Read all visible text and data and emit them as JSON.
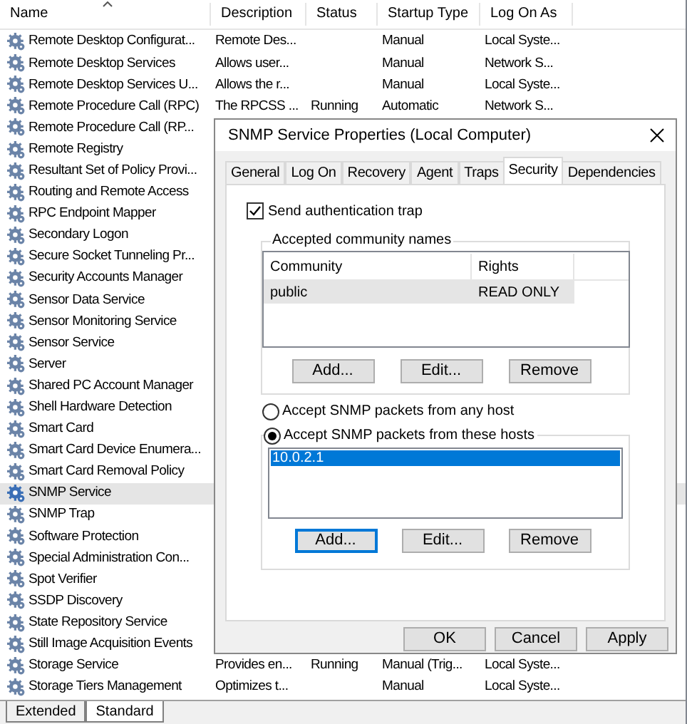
{
  "services": {
    "columns": [
      "Name",
      "Description",
      "Status",
      "Startup Type",
      "Log On As"
    ],
    "rows": [
      {
        "name": "Remote Desktop Configurat...",
        "description": "Remote Des...",
        "startup_type": "Manual",
        "log_on_as": "Local Syste...",
        "selected": false
      },
      {
        "name": "Remote Desktop Services",
        "description": "Allows user...",
        "startup_type": "Manual",
        "log_on_as": "Network S...",
        "selected": false
      },
      {
        "name": "Remote Desktop Services U...",
        "description": "Allows the r...",
        "startup_type": "Manual",
        "log_on_as": "Local Syste...",
        "selected": false
      },
      {
        "name": "Remote Procedure Call (RPC)",
        "description": "The RPCSS ...",
        "status": "Running",
        "startup_type": "Automatic",
        "log_on_as": "Network S...",
        "selected": false
      },
      {
        "name": "Remote Procedure Call (RP...",
        "selected": false
      },
      {
        "name": "Remote Registry",
        "selected": false
      },
      {
        "name": "Resultant Set of Policy Provi...",
        "selected": false
      },
      {
        "name": "Routing and Remote Access",
        "selected": false
      },
      {
        "name": "RPC Endpoint Mapper",
        "selected": false
      },
      {
        "name": "Secondary Logon",
        "selected": false
      },
      {
        "name": "Secure Socket Tunneling Pr...",
        "selected": false
      },
      {
        "name": "Security Accounts Manager",
        "selected": false
      },
      {
        "name": "Sensor Data Service",
        "selected": false
      },
      {
        "name": "Sensor Monitoring Service",
        "selected": false
      },
      {
        "name": "Sensor Service",
        "selected": false
      },
      {
        "name": "Server",
        "selected": false
      },
      {
        "name": "Shared PC Account Manager",
        "selected": false
      },
      {
        "name": "Shell Hardware Detection",
        "selected": false
      },
      {
        "name": "Smart Card",
        "selected": false
      },
      {
        "name": "Smart Card Device Enumera...",
        "selected": false
      },
      {
        "name": "Smart Card Removal Policy",
        "selected": false
      },
      {
        "name": "SNMP Service",
        "selected": true
      },
      {
        "name": "SNMP Trap",
        "selected": false
      },
      {
        "name": "Software Protection",
        "selected": false
      },
      {
        "name": "Special Administration Con...",
        "selected": false
      },
      {
        "name": "Spot Verifier",
        "selected": false
      },
      {
        "name": "SSDP Discovery",
        "selected": false
      },
      {
        "name": "State Repository Service",
        "selected": false
      },
      {
        "name": "Still Image Acquisition Events",
        "selected": false
      },
      {
        "name": "Storage Service",
        "description": "Provides en...",
        "status": "Running",
        "startup_type": "Manual (Trig...",
        "log_on_as": "Local Syste...",
        "selected": false
      },
      {
        "name": "Storage Tiers Management",
        "description": "Optimizes t...",
        "startup_type": "Manual",
        "log_on_as": "Local Syste...",
        "selected": false
      }
    ]
  },
  "view_tabs": [
    {
      "label": "Extended",
      "selected": false
    },
    {
      "label": "Standard",
      "selected": true
    }
  ],
  "dialog": {
    "title": "SNMP Service Properties (Local Computer)",
    "tabs": [
      {
        "label": "General",
        "selected": false
      },
      {
        "label": "Log On",
        "selected": false
      },
      {
        "label": "Recovery",
        "selected": false
      },
      {
        "label": "Agent",
        "selected": false
      },
      {
        "label": "Traps",
        "selected": false
      },
      {
        "label": "Security",
        "selected": true
      },
      {
        "label": "Dependencies",
        "selected": false
      }
    ],
    "send_auth_trap": {
      "label": "Send authentication trap",
      "checked": true
    },
    "community_group": {
      "title": "Accepted community names",
      "columns": [
        "Community",
        "Rights"
      ],
      "rows": [
        {
          "community": "public",
          "rights": "READ ONLY",
          "selected": true
        }
      ],
      "buttons": [
        {
          "label": "Add...",
          "focused": false
        },
        {
          "label": "Edit...",
          "focused": false
        },
        {
          "label": "Remove",
          "focused": false
        }
      ]
    },
    "host_options": [
      {
        "label": "Accept SNMP packets from any host",
        "selected": false
      },
      {
        "label": "Accept SNMP packets from these hosts",
        "selected": true
      }
    ],
    "hosts": [
      {
        "address": "10.0.2.1",
        "selected": true
      }
    ],
    "host_buttons": [
      {
        "label": "Add...",
        "focused": true
      },
      {
        "label": "Edit...",
        "focused": false
      },
      {
        "label": "Remove",
        "focused": false
      }
    ],
    "footer_buttons": [
      "OK",
      "Cancel",
      "Apply"
    ]
  }
}
